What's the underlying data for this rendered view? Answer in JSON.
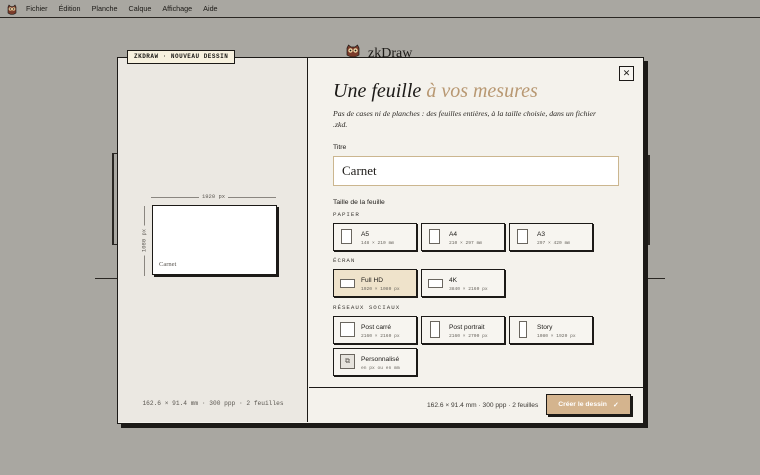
{
  "menubar": {
    "logo_icon": "owl-icon",
    "items": [
      "Fichier",
      "Édition",
      "Planche",
      "Calque",
      "Affichage",
      "Aide"
    ]
  },
  "background": {
    "app_name": "zkDraw"
  },
  "modal": {
    "tag": "ZKDRAW · NOUVEAU DESSIN",
    "heading_main": "Une feuille",
    "heading_accent": "à vos mesures",
    "subtitle": "Pas de cases ni de planches : des feuilles entières, à la taille choisie, dans un fichier .zkd.",
    "close_icon": "close-icon",
    "title_label": "Titre",
    "title_value": "Carnet",
    "size_label": "Taille de la feuille",
    "groups": {
      "paper": {
        "label": "PAPIER",
        "options": [
          {
            "name": "A5",
            "size": "148 × 210 mm"
          },
          {
            "name": "A4",
            "size": "210 × 297 mm"
          },
          {
            "name": "A3",
            "size": "297 × 420 mm"
          }
        ]
      },
      "screen": {
        "label": "ÉCRAN",
        "options": [
          {
            "name": "Full HD",
            "size": "1920 × 1080 px",
            "selected": true
          },
          {
            "name": "4K",
            "size": "3840 × 2160 px"
          }
        ]
      },
      "social": {
        "label": "RÉSEAUX SOCIAUX",
        "options": [
          {
            "name": "Post carré",
            "size": "2160 × 2160 px"
          },
          {
            "name": "Post portrait",
            "size": "2160 × 2700 px"
          },
          {
            "name": "Story",
            "size": "1080 × 1920 px"
          }
        ]
      },
      "custom": {
        "name": "Personnalisé",
        "size": "en px ou en mm"
      }
    },
    "preview": {
      "width_label": "1920 px",
      "height_label": "1080 px",
      "sheet_name": "Carnet",
      "footer": "162.6 × 91.4 mm · 300 ppp · 2 feuilles"
    },
    "footer_summary": "162.6 × 91.4 mm · 300 ppp · 2 feuilles",
    "create_label": "Créer le dessin",
    "create_icon": "check-icon"
  },
  "colors": {
    "accent": "#b89872",
    "button": "#d4b48e",
    "selected_option": "#efe3cb",
    "backdrop": "#a9a7a1"
  }
}
